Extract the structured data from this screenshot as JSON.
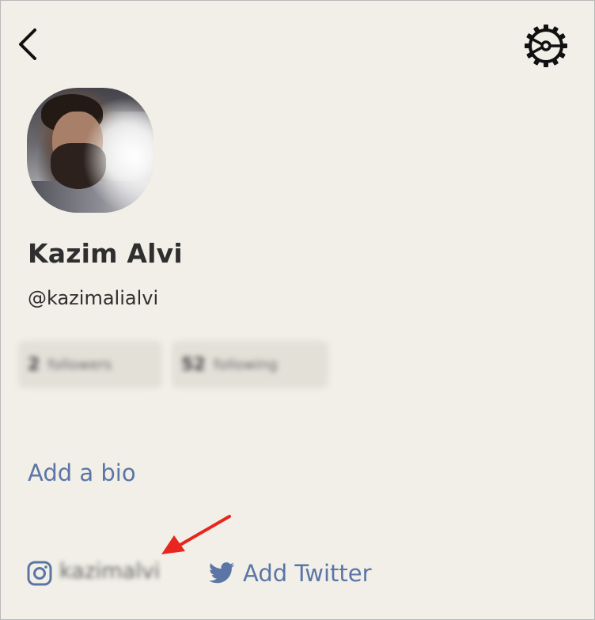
{
  "header": {
    "back_icon": "chevron-left-icon",
    "settings_icon": "gear-icon"
  },
  "profile": {
    "name": "Kazim Alvi",
    "handle": "@kazimalialvi",
    "avatar": "profile-photo"
  },
  "stats": [
    {
      "count": "2",
      "label": "followers"
    },
    {
      "count": "52",
      "label": "following"
    }
  ],
  "bio": {
    "add_bio_label": "Add a bio"
  },
  "social": {
    "instagram_icon": "instagram-icon",
    "instagram_handle": "kazimalvi",
    "twitter_icon": "twitter-icon",
    "add_twitter_label": "Add Twitter"
  },
  "colors": {
    "background": "#f1efe7",
    "link": "#5b76a6",
    "text": "#2f2f2f",
    "annotation_arrow": "#e8251f"
  }
}
